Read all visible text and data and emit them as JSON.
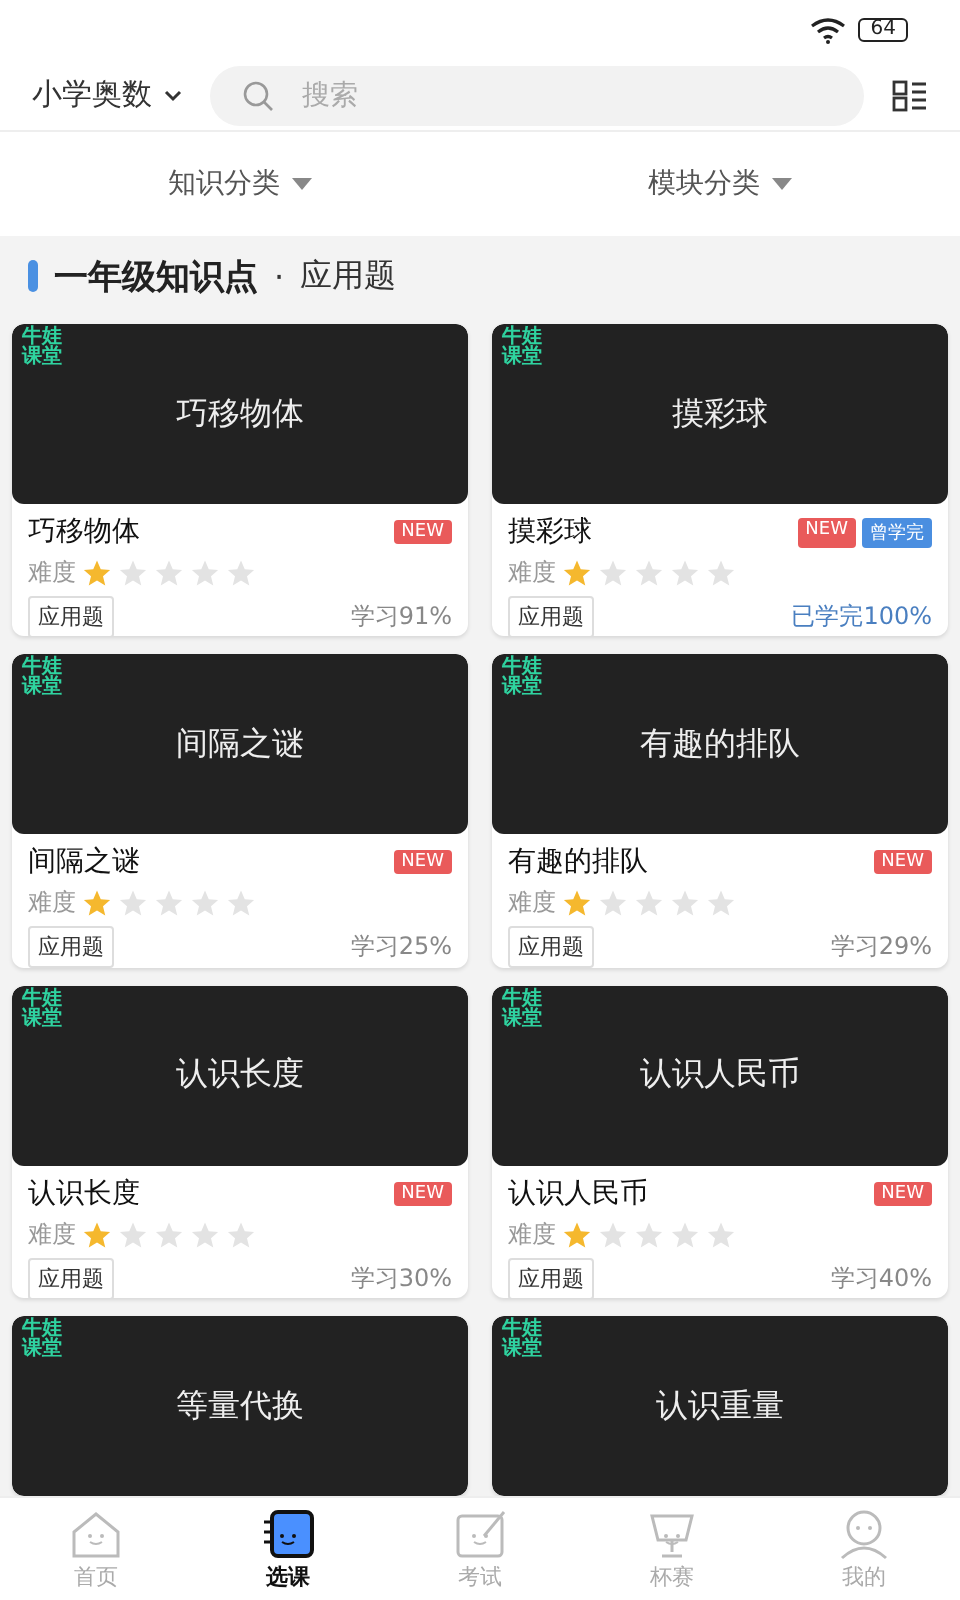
{
  "status_bar": {
    "battery": "64"
  },
  "header": {
    "subject": "小学奥数",
    "search": {
      "placeholder": "搜索"
    }
  },
  "filters": [
    {
      "label": "知识分类"
    },
    {
      "label": "模块分类"
    }
  ],
  "section": {
    "title": "一年级知识点",
    "separator": "·",
    "subtitle": "应用题"
  },
  "courses": [
    {
      "logo": [
        "牛娃",
        "课堂"
      ],
      "thumb_title": "巧移物体",
      "title": "巧移物体",
      "badges": [
        {
          "label": "NEW",
          "kind": "new"
        }
      ],
      "difficulty_label": "难度",
      "stars": 1,
      "tag": "应用题",
      "progress": "学习91%",
      "completed": false
    },
    {
      "logo": [
        "牛娃",
        "课堂"
      ],
      "thumb_title": "摸彩球",
      "title": "摸彩球",
      "badges": [
        {
          "label": "NEW",
          "kind": "new"
        },
        {
          "label": "曾学完",
          "kind": "done"
        }
      ],
      "difficulty_label": "难度",
      "stars": 1,
      "tag": "应用题",
      "progress": "已学完100%",
      "completed": true
    },
    {
      "logo": [
        "牛娃",
        "课堂"
      ],
      "thumb_title": "间隔之谜",
      "title": "间隔之谜",
      "badges": [
        {
          "label": "NEW",
          "kind": "new"
        }
      ],
      "difficulty_label": "难度",
      "stars": 1,
      "tag": "应用题",
      "progress": "学习25%",
      "completed": false
    },
    {
      "logo": [
        "牛娃",
        "课堂"
      ],
      "thumb_title": "有趣的排队",
      "title": "有趣的排队",
      "badges": [
        {
          "label": "NEW",
          "kind": "new"
        }
      ],
      "difficulty_label": "难度",
      "stars": 1,
      "tag": "应用题",
      "progress": "学习29%",
      "completed": false
    },
    {
      "logo": [
        "牛娃",
        "课堂"
      ],
      "thumb_title": "认识长度",
      "title": "认识长度",
      "badges": [
        {
          "label": "NEW",
          "kind": "new"
        }
      ],
      "difficulty_label": "难度",
      "stars": 1,
      "tag": "应用题",
      "progress": "学习30%",
      "completed": false
    },
    {
      "logo": [
        "牛娃",
        "课堂"
      ],
      "thumb_title": "认识人民币",
      "title": "认识人民币",
      "badges": [
        {
          "label": "NEW",
          "kind": "new"
        }
      ],
      "difficulty_label": "难度",
      "stars": 1,
      "tag": "应用题",
      "progress": "学习40%",
      "completed": false
    },
    {
      "logo": [
        "牛娃",
        "课堂"
      ],
      "thumb_title": "等量代换"
    },
    {
      "logo": [
        "牛娃",
        "课堂"
      ],
      "thumb_title": "认识重量"
    }
  ],
  "tab_bar": [
    {
      "label": "首页",
      "kind": "home",
      "selected": false
    },
    {
      "label": "选课",
      "kind": "course",
      "selected": true
    },
    {
      "label": "考试",
      "kind": "exam",
      "selected": false
    },
    {
      "label": "杯赛",
      "kind": "cup",
      "selected": false
    },
    {
      "label": "我的",
      "kind": "me",
      "selected": false
    }
  ]
}
